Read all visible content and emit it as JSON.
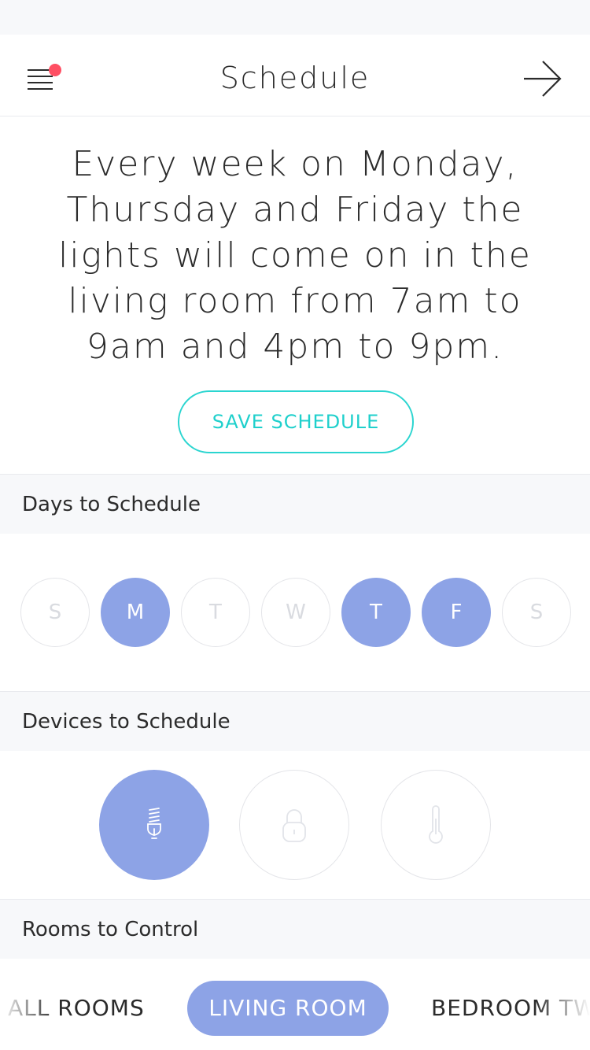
{
  "nav": {
    "title": "Schedule",
    "menu_icon": "menu-icon",
    "notification_color": "#ff4f63",
    "next_icon": "arrow-right-icon"
  },
  "summary": "Every week on Monday, Thursday and Friday the lights will come on in the living room from 7am to 9am and 4pm to 9pm.",
  "save_button": "SAVE SCHEDULE",
  "days_section": {
    "title": "Days to Schedule",
    "days": [
      {
        "label": "S",
        "selected": false
      },
      {
        "label": "M",
        "selected": true
      },
      {
        "label": "T",
        "selected": false
      },
      {
        "label": "W",
        "selected": false
      },
      {
        "label": "T",
        "selected": true
      },
      {
        "label": "F",
        "selected": true
      },
      {
        "label": "S",
        "selected": false
      }
    ]
  },
  "devices_section": {
    "title": "Devices to Schedule",
    "devices": [
      {
        "icon": "light-bulb-icon",
        "selected": true
      },
      {
        "icon": "lock-icon",
        "selected": false
      },
      {
        "icon": "thermometer-icon",
        "selected": false
      }
    ]
  },
  "rooms_section": {
    "title": "Rooms to Control",
    "rooms": [
      {
        "label": "ALL ROOMS",
        "selected": false
      },
      {
        "label": "LIVING ROOM",
        "selected": true
      },
      {
        "label": "BEDROOM TWO",
        "selected": false
      }
    ]
  },
  "colors": {
    "accent": "#8da3e6",
    "teal": "#1fd0cc"
  }
}
